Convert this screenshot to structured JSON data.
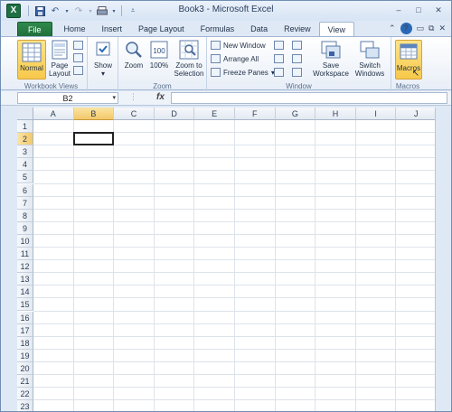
{
  "window": {
    "title": "Book3 - Microsoft Excel"
  },
  "titlebar": {
    "app_icon": "excel-icon",
    "controls": {
      "minimize": "–",
      "restore": "□",
      "close": "✕"
    }
  },
  "tabs": [
    {
      "label": "File"
    },
    {
      "label": "Home"
    },
    {
      "label": "Insert"
    },
    {
      "label": "Page Layout"
    },
    {
      "label": "Formulas"
    },
    {
      "label": "Data"
    },
    {
      "label": "Review"
    },
    {
      "label": "View"
    }
  ],
  "ribbon": {
    "workbook_views": {
      "label": "Workbook Views",
      "normal": "Normal",
      "page_layout_1": "Page",
      "page_layout_2": "Layout"
    },
    "show": {
      "label": "Show"
    },
    "zoom": {
      "label": "Zoom",
      "zoom": "Zoom",
      "hundred": "100%",
      "zoom_sel_1": "Zoom to",
      "zoom_sel_2": "Selection"
    },
    "window": {
      "label": "Window",
      "new_window": "New Window",
      "arrange_all": "Arrange All",
      "freeze_panes": "Freeze Panes",
      "save_ws_1": "Save",
      "save_ws_2": "Workspace",
      "switch_1": "Switch",
      "switch_2": "Windows"
    },
    "macros": {
      "label": "Macros",
      "button": "Macros"
    }
  },
  "formula_bar": {
    "name_box": "B2",
    "fx": "fx",
    "value": ""
  },
  "grid": {
    "columns": [
      "A",
      "B",
      "C",
      "D",
      "E",
      "F",
      "G",
      "H",
      "I",
      "J"
    ],
    "rows": [
      "1",
      "2",
      "3",
      "4",
      "5",
      "6",
      "7",
      "8",
      "9",
      "10",
      "11",
      "12",
      "13",
      "14",
      "15",
      "16",
      "17",
      "18",
      "19",
      "20",
      "21",
      "22",
      "23"
    ],
    "active_cell": "B2",
    "selected_col": "B",
    "selected_row": "2"
  },
  "colors": {
    "file_tab": "#1e6d3a",
    "selection_header": "#f3c86a",
    "ribbon_border": "#9eb5d3"
  }
}
